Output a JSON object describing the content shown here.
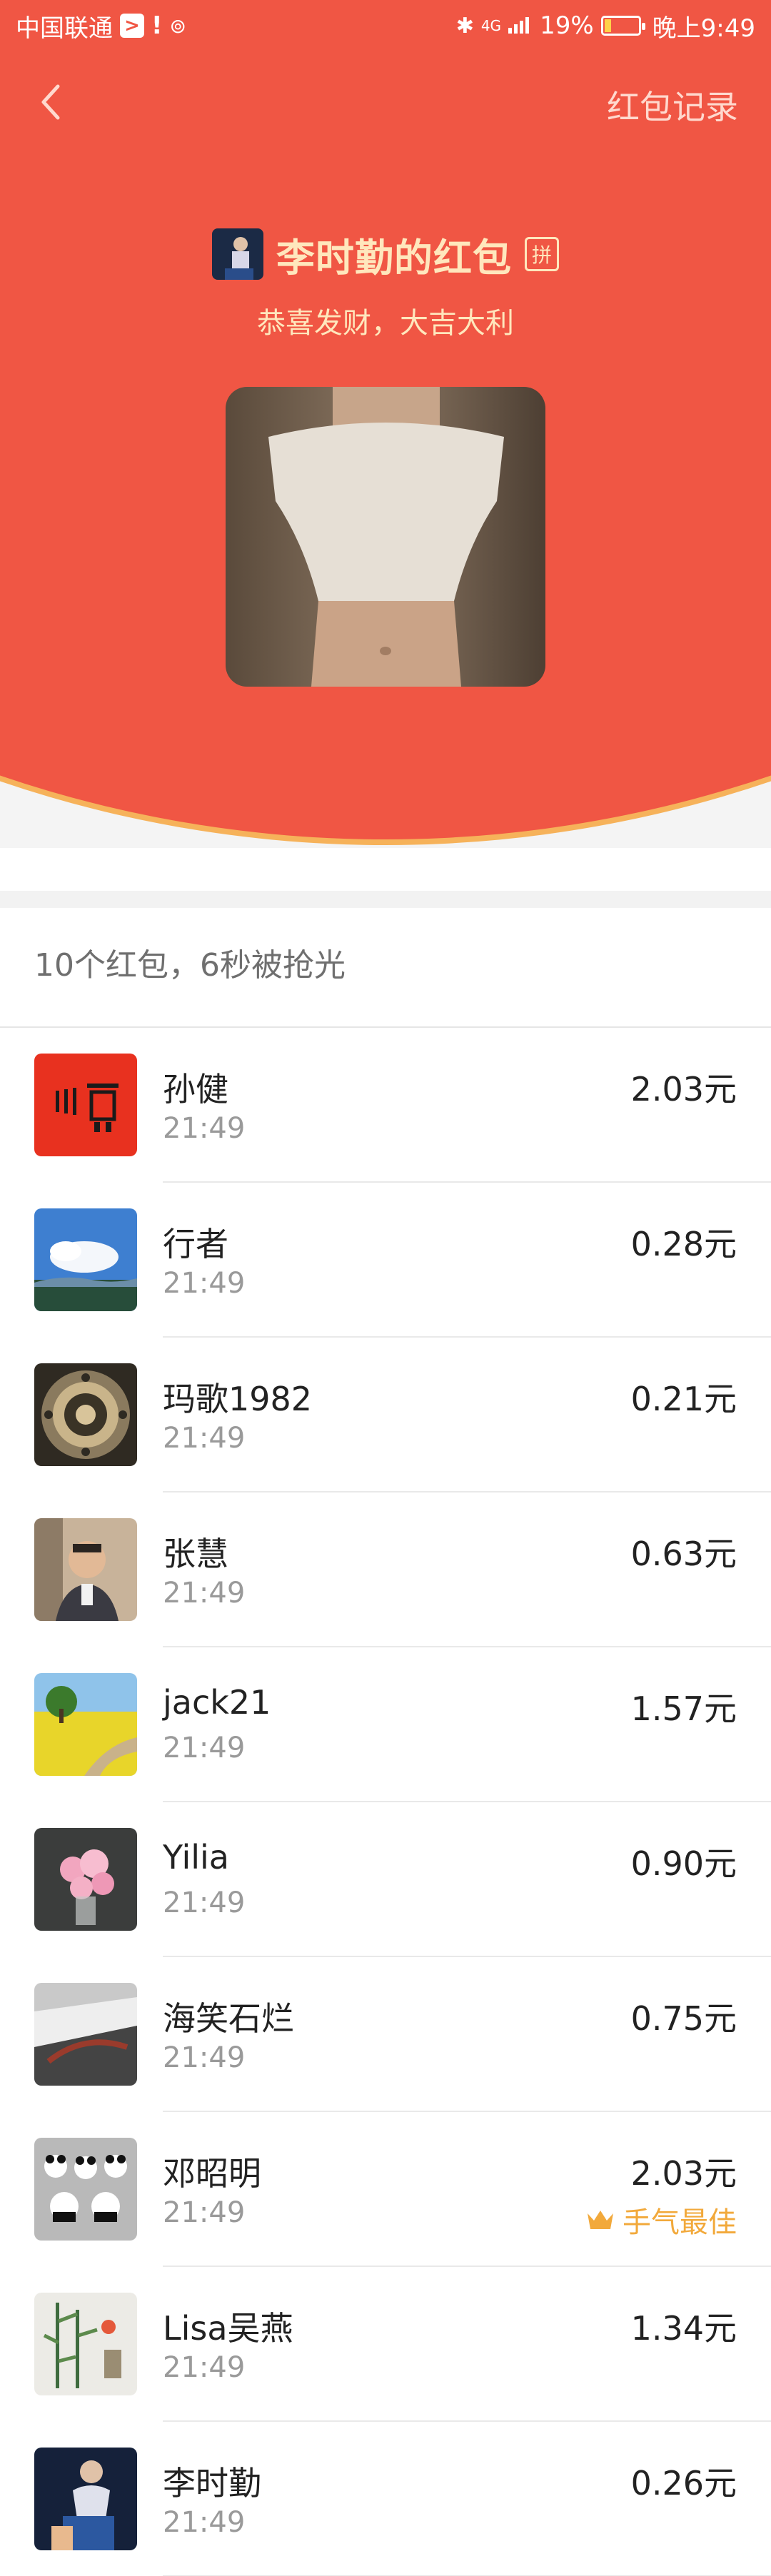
{
  "status_bar": {
    "carrier": "中国联通",
    "network": "4G",
    "battery": "19%",
    "battery_level": 0.19,
    "time": "晚上9:49"
  },
  "header": {
    "records_label": "红包记录",
    "title": "李时勤的红包",
    "pin_badge": "拼",
    "wish": "恭喜发财，大吉大利",
    "accent_color": "#f05644",
    "gold_text_color": "#ffe7bd"
  },
  "summary": {
    "text": "10个红包，6秒被抢光"
  },
  "list": [
    {
      "name": "孙健",
      "time": "21:49",
      "amount": "2.03元"
    },
    {
      "name": "行者",
      "time": "21:49",
      "amount": "0.28元"
    },
    {
      "name": "玛歌1982",
      "time": "21:49",
      "amount": "0.21元"
    },
    {
      "name": "张慧",
      "time": "21:49",
      "amount": "0.63元"
    },
    {
      "name": "jack21",
      "time": "21:49",
      "amount": "1.57元"
    },
    {
      "name": "Yilia",
      "time": "21:49",
      "amount": "0.90元"
    },
    {
      "name": "海笑石烂",
      "time": "21:49",
      "amount": "0.75元"
    },
    {
      "name": "邓昭明",
      "time": "21:49",
      "amount": "2.03元",
      "badge": "手气最佳",
      "badge_icon": "crown-icon"
    },
    {
      "name": "Lisa吴燕",
      "time": "21:49",
      "amount": "1.34元"
    },
    {
      "name": "李时勤",
      "time": "21:49",
      "amount": "0.26元"
    }
  ]
}
